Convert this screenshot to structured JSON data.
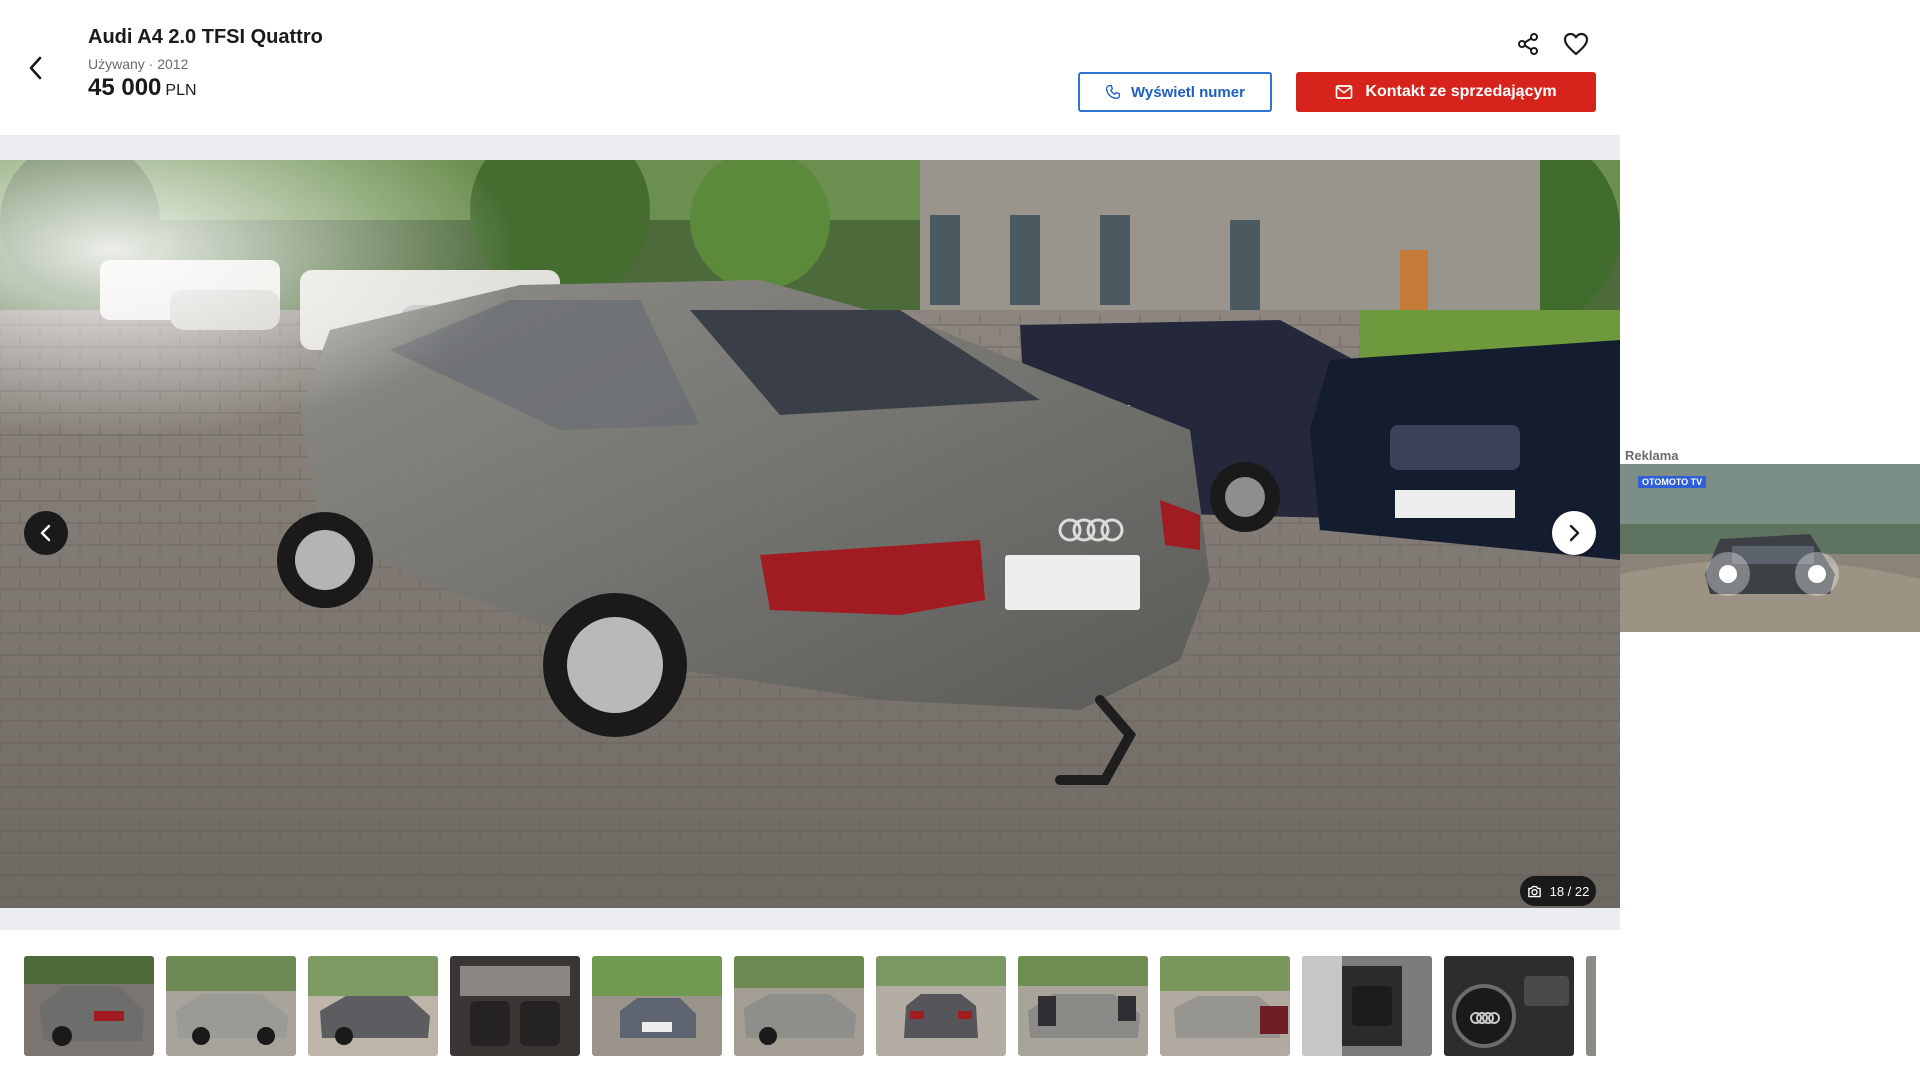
{
  "listing": {
    "title": "Audi A4 2.0 TFSI Quattro",
    "condition_year": "Używany · 2012",
    "price_amount": "45 000",
    "price_currency": "PLN"
  },
  "actions": {
    "show_number_label": "Wyświetl numer",
    "contact_label": "Kontakt ze sprzedającym"
  },
  "gallery": {
    "counter": "18 / 22",
    "current_index": 18,
    "total": 22
  },
  "ad": {
    "label": "Reklama",
    "logo_text": "OTOMOTO TV"
  },
  "colors": {
    "accent_red": "#d6231b",
    "accent_blue": "#2c74d6",
    "dark": "#1a1a1a"
  },
  "icons": {
    "back": "chevron-left-icon",
    "share": "share-icon",
    "favorite": "heart-icon",
    "phone": "phone-icon",
    "mail": "mail-icon",
    "camera": "camera-icon",
    "prev": "chevron-left-icon",
    "next": "chevron-right-icon"
  }
}
